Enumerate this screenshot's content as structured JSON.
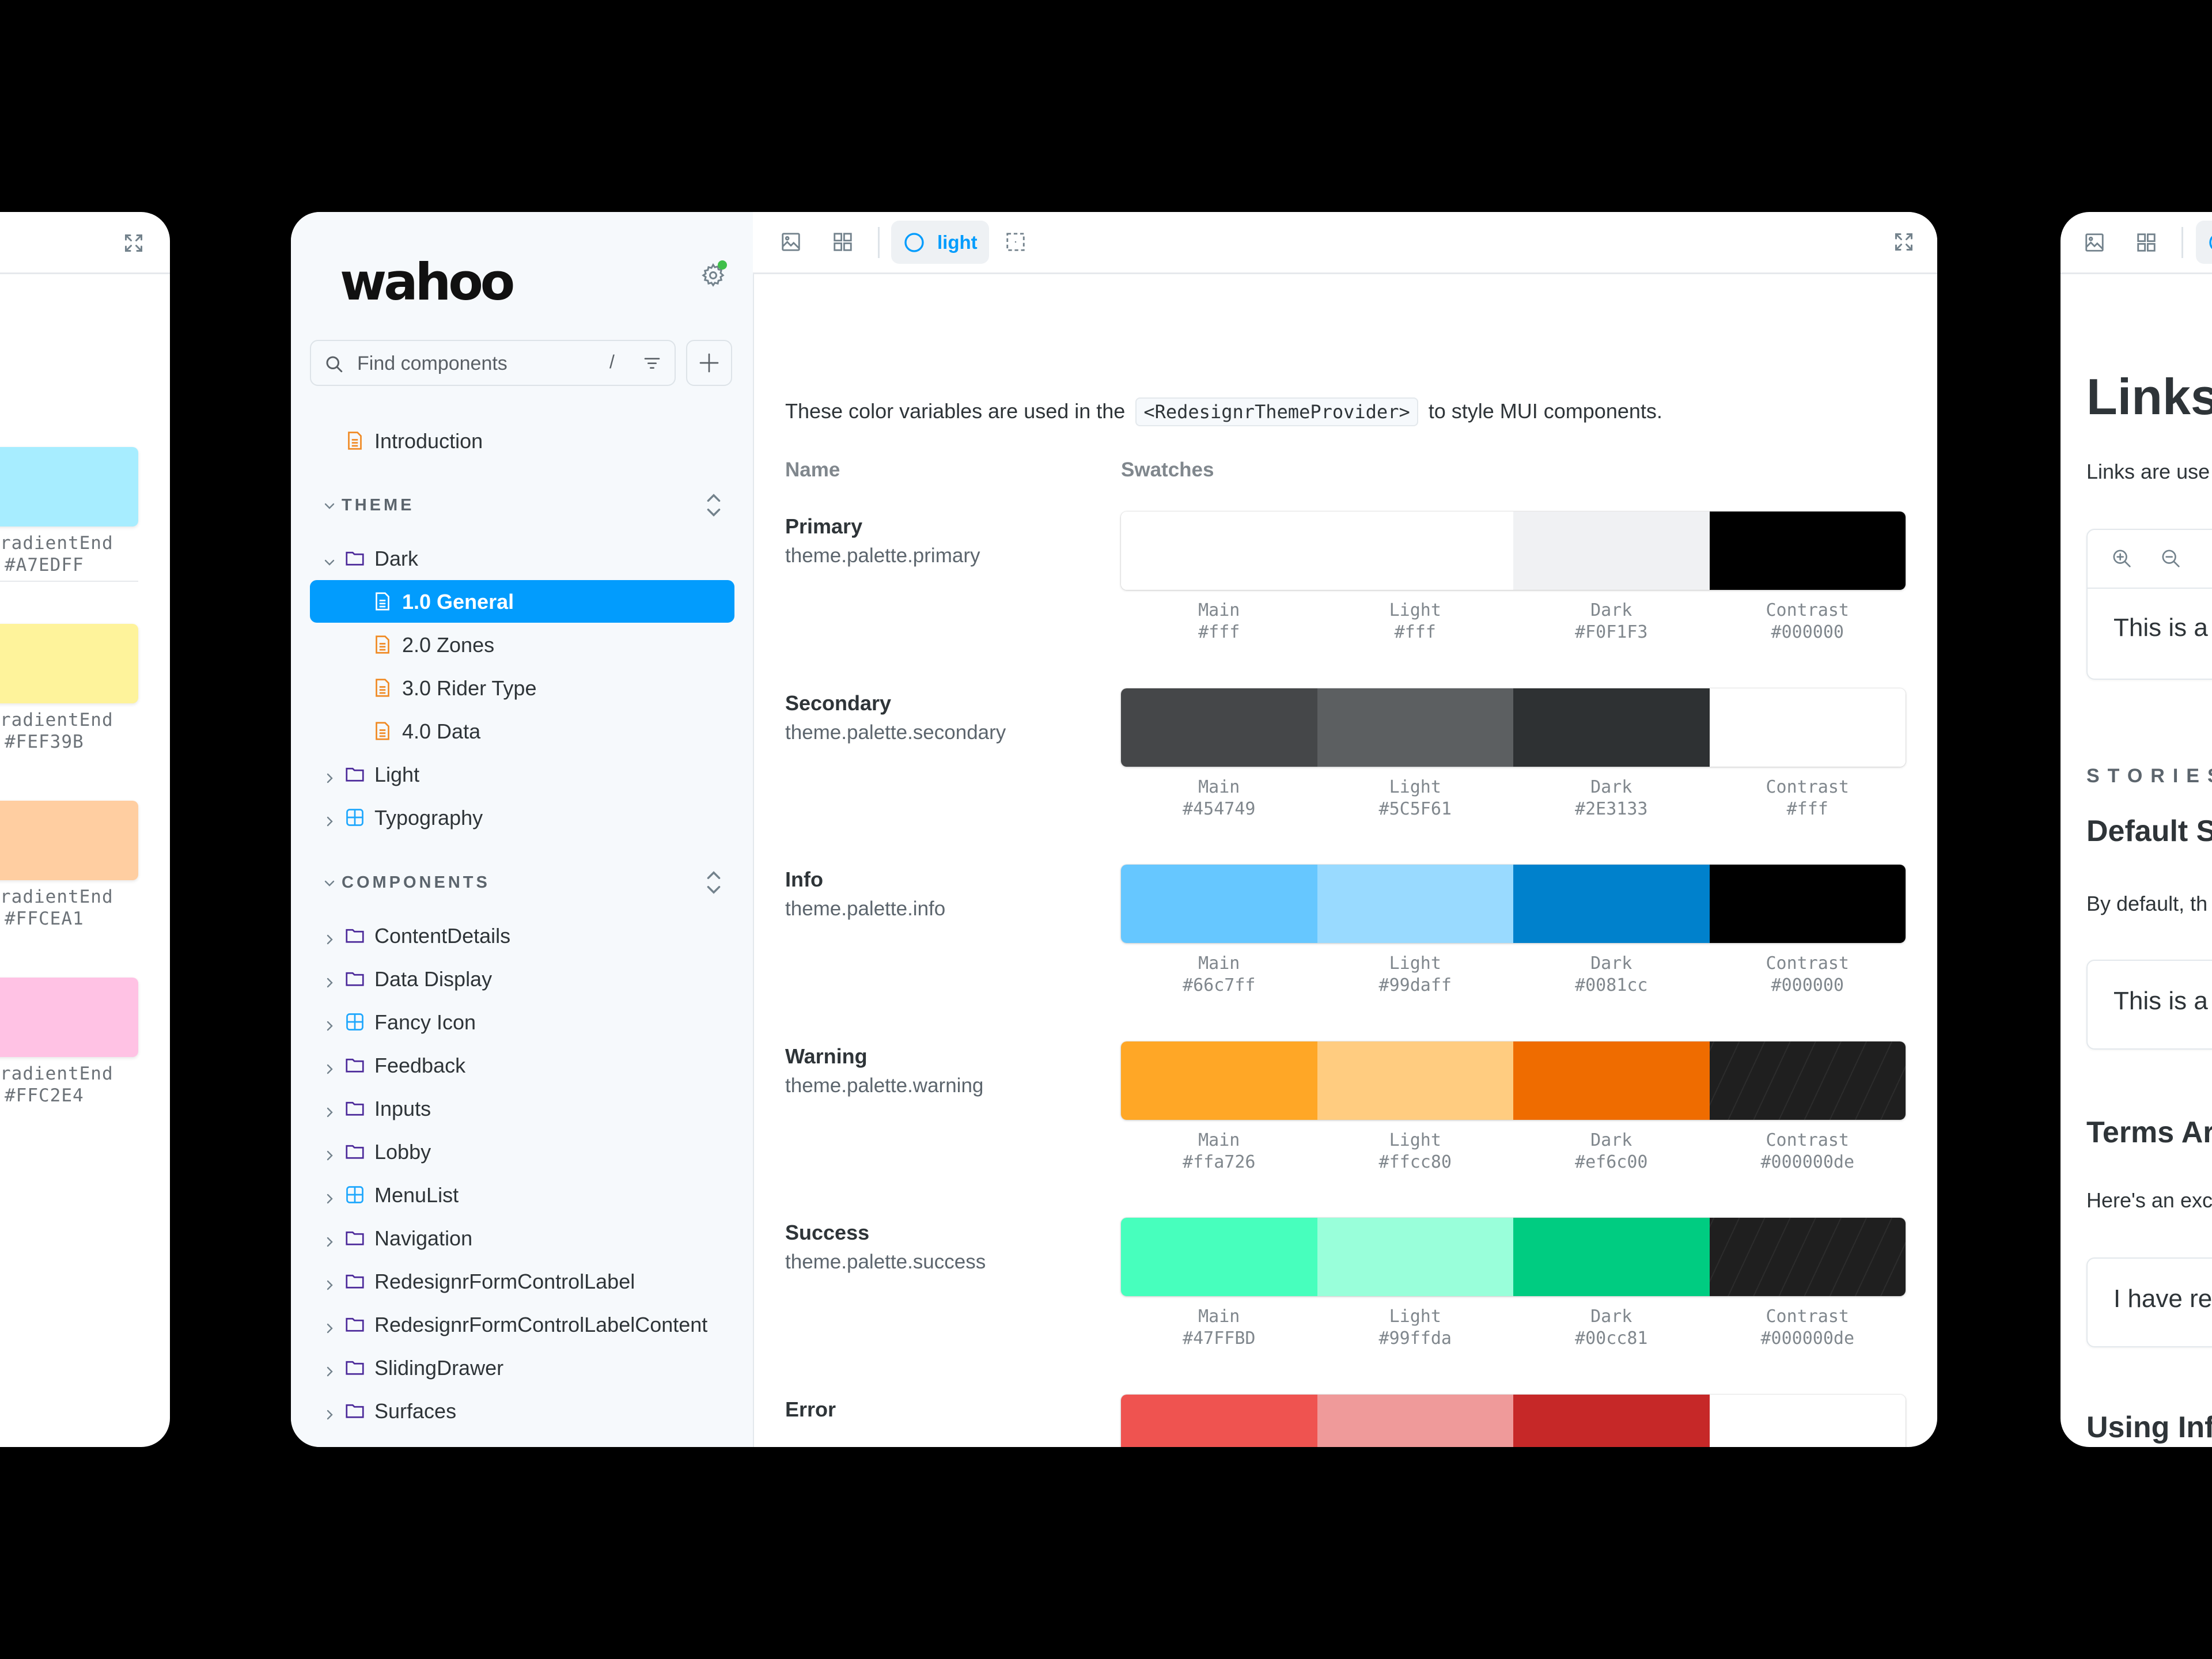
{
  "left_panel": {
    "fullscreen_icon": "fullscreen-icon",
    "gradient_swatches": [
      {
        "label": "radientEnd",
        "hex": "#A7EDFF",
        "color": "#A7EDFF"
      },
      {
        "label": "radientEnd",
        "hex": "#FEF39B",
        "color": "#FEF39B"
      },
      {
        "label": "radientEnd",
        "hex": "#FFCEA1",
        "color": "#FFCEA1"
      },
      {
        "label": "radientEnd",
        "hex": "#FFC2E4",
        "color": "#FFC2E4"
      }
    ]
  },
  "sidebar": {
    "logo": "wahoo",
    "search": {
      "placeholder": "Find components",
      "shortcut": "/"
    },
    "intro_item": {
      "label": "Introduction",
      "icon": "document-icon"
    },
    "theme_section": {
      "title": "THEME",
      "items": [
        {
          "label": "Dark",
          "icon": "folder-icon",
          "expanded": true,
          "level": 0
        },
        {
          "label": "1.0 General",
          "icon": "document-icon",
          "level": 1,
          "selected": true
        },
        {
          "label": "2.0 Zones",
          "icon": "document-icon",
          "level": 1
        },
        {
          "label": "3.0 Rider Type",
          "icon": "document-icon",
          "level": 1
        },
        {
          "label": "4.0 Data",
          "icon": "document-icon",
          "level": 1
        },
        {
          "label": "Light",
          "icon": "folder-icon",
          "expanded": false,
          "level": 0
        },
        {
          "label": "Typography",
          "icon": "component-icon",
          "expanded": false,
          "level": 0
        }
      ]
    },
    "components_section": {
      "title": "COMPONENTS",
      "items": [
        {
          "label": "ContentDetails",
          "icon": "folder-icon"
        },
        {
          "label": "Data Display",
          "icon": "folder-icon"
        },
        {
          "label": "Fancy Icon",
          "icon": "component-icon"
        },
        {
          "label": "Feedback",
          "icon": "folder-icon"
        },
        {
          "label": "Inputs",
          "icon": "folder-icon"
        },
        {
          "label": "Lobby",
          "icon": "folder-icon"
        },
        {
          "label": "MenuList",
          "icon": "component-icon"
        },
        {
          "label": "Navigation",
          "icon": "folder-icon"
        },
        {
          "label": "RedesignrFormControlLabel",
          "icon": "folder-icon"
        },
        {
          "label": "RedesignrFormControlLabelContent",
          "icon": "folder-icon"
        },
        {
          "label": "SlidingDrawer",
          "icon": "folder-icon"
        },
        {
          "label": "Surfaces",
          "icon": "folder-icon"
        },
        {
          "label": "",
          "icon": "folder-icon"
        }
      ]
    }
  },
  "toolbar": {
    "theme_label": "light"
  },
  "content": {
    "intro_before": "These color variables are used in the",
    "intro_code": "<RedesignrThemeProvider>",
    "intro_after": "to style MUI components.",
    "col_name": "Name",
    "col_swatches": "Swatches",
    "palettes": [
      {
        "name": "Primary",
        "path": "theme.palette.primary",
        "swatches": [
          {
            "label": "Main",
            "hex": "#fff",
            "color": "#ffffff"
          },
          {
            "label": "Light",
            "hex": "#fff",
            "color": "#ffffff"
          },
          {
            "label": "Dark",
            "hex": "#F0F1F3",
            "color": "#F0F1F3"
          },
          {
            "label": "Contrast",
            "hex": "#000000",
            "color": "#000000"
          }
        ]
      },
      {
        "name": "Secondary",
        "path": "theme.palette.secondary",
        "swatches": [
          {
            "label": "Main",
            "hex": "#454749",
            "color": "#454749"
          },
          {
            "label": "Light",
            "hex": "#5C5F61",
            "color": "#5C5F61"
          },
          {
            "label": "Dark",
            "hex": "#2E3133",
            "color": "#2E3133"
          },
          {
            "label": "Contrast",
            "hex": "#fff",
            "color": "#ffffff"
          }
        ]
      },
      {
        "name": "Info",
        "path": "theme.palette.info",
        "swatches": [
          {
            "label": "Main",
            "hex": "#66c7ff",
            "color": "#66c7ff"
          },
          {
            "label": "Light",
            "hex": "#99daff",
            "color": "#99daff"
          },
          {
            "label": "Dark",
            "hex": "#0081cc",
            "color": "#0081cc"
          },
          {
            "label": "Contrast",
            "hex": "#000000",
            "color": "#000000"
          }
        ]
      },
      {
        "name": "Warning",
        "path": "theme.palette.warning",
        "swatches": [
          {
            "label": "Main",
            "hex": "#ffa726",
            "color": "#ffa726"
          },
          {
            "label": "Light",
            "hex": "#ffcc80",
            "color": "#ffcc80"
          },
          {
            "label": "Dark",
            "hex": "#ef6c00",
            "color": "#ef6c00"
          },
          {
            "label": "Contrast",
            "hex": "#000000de",
            "color": "#1f1f1f",
            "hatched": true
          }
        ]
      },
      {
        "name": "Success",
        "path": "theme.palette.success",
        "swatches": [
          {
            "label": "Main",
            "hex": "#47FFBD",
            "color": "#47FFBD"
          },
          {
            "label": "Light",
            "hex": "#99ffda",
            "color": "#99ffda"
          },
          {
            "label": "Dark",
            "hex": "#00cc81",
            "color": "#00cc81"
          },
          {
            "label": "Contrast",
            "hex": "#000000de",
            "color": "#1f1f1f",
            "hatched": true
          }
        ]
      },
      {
        "name": "Error",
        "path": "",
        "swatches": [
          {
            "label": "",
            "hex": "",
            "color": "#EF5350"
          },
          {
            "label": "",
            "hex": "",
            "color": "#EF9A9A"
          },
          {
            "label": "",
            "hex": "",
            "color": "#C62828"
          },
          {
            "label": "",
            "hex": "",
            "color": "#ffffff"
          }
        ]
      }
    ]
  },
  "right_panel": {
    "title": "Links",
    "subtitle": "Links are use",
    "preview_text": "This is a",
    "stories_label": "STORIES",
    "story1_title": "Default S",
    "story1_desc": "By default, th",
    "story1_preview": "This is a",
    "story2_title": "Terms Ar",
    "story2_desc": "Here's an exc",
    "story2_preview": "I have re",
    "story3_title": "Using Inf"
  },
  "colors": {
    "accent": "#029CFD",
    "sidebar_bg": "#F6F9FC",
    "folder_icon": "#4C2A9A",
    "document_icon": "#F08A24",
    "component_icon": "#1EA7FD",
    "status_dot": "#3FBF4A"
  }
}
